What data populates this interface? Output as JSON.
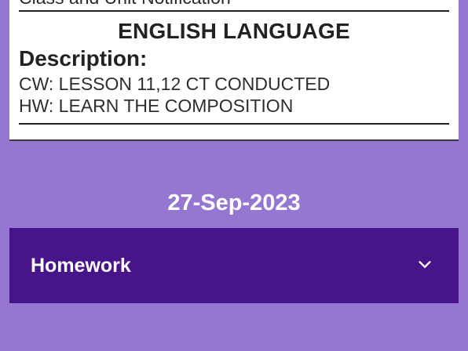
{
  "card": {
    "partial_text": "Class and Unit Notification",
    "subject": "ENGLISH LANGUAGE",
    "description_label": "Description:",
    "description_lines": [
      "CW: LESSON 11,12 CT CONDUCTED",
      "HW: LEARN THE COMPOSITION"
    ]
  },
  "date_header": "27-Sep-2023",
  "accordion": {
    "label": "Homework",
    "icon": "chevron-down-icon"
  },
  "colors": {
    "background": "#9577d1",
    "accordion_bg": "#48148a",
    "card_bg": "#ffffff"
  }
}
